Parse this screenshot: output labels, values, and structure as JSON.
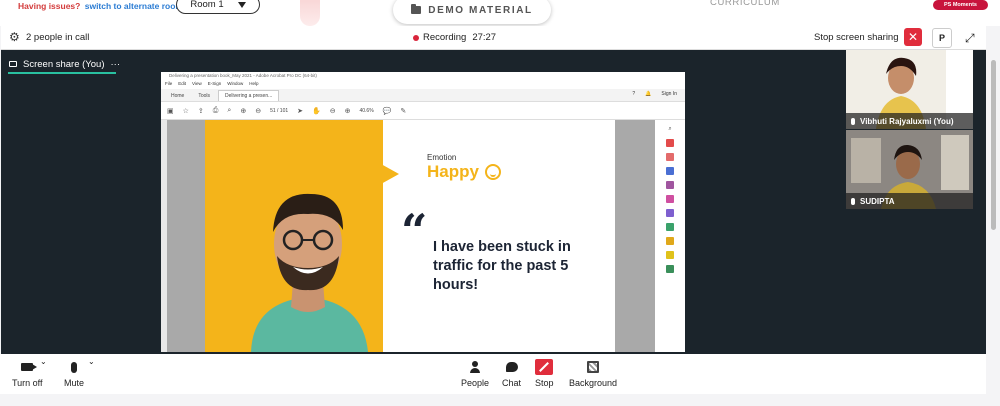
{
  "top": {
    "issues_text": "Having issues?",
    "alt_room_link": "switch to alternate room",
    "room_select": "Room 1",
    "demo_material": "DEMO MATERIAL",
    "curriculum": "CURRICULUM",
    "moments_badge": "PS Moments"
  },
  "header": {
    "people_in_call": "2 people in call",
    "recording_label": "Recording",
    "recording_time": "27:27",
    "stop_sharing": "Stop screen sharing",
    "p_button": "P"
  },
  "stage": {
    "share_tab_label": "Screen share (You)",
    "share_tab_more": "···"
  },
  "shared_app": {
    "title": "Delivering a presentation book_May 2021 - Adobe Acrobat Pro DC (64-bit)",
    "menu": [
      "File",
      "Edit",
      "View",
      "E-Sign",
      "Window",
      "Help"
    ],
    "tabs": [
      "Home",
      "Tools",
      "Delivering a presen..."
    ],
    "sign_in": "Sign In",
    "page_indicator": "51 / 101",
    "zoom": "40.6%"
  },
  "slide": {
    "emotion_label": "Emotion",
    "emotion_value": "Happy",
    "quote_mark": "“",
    "quote": "I have been stuck in traffic for the past 5 hours!"
  },
  "participants": [
    {
      "name": "Vibhuti Rajyaluxmi (You)"
    },
    {
      "name": "SUDIPTA"
    }
  ],
  "toolbar": {
    "turn_off": "Turn off",
    "mute": "Mute",
    "people": "People",
    "chat": "Chat",
    "stop": "Stop",
    "background": "Background"
  },
  "colors": {
    "accent_teal": "#29c0a0",
    "recording_red": "#d9253b",
    "slide_yellow": "#f4b41a",
    "slide_navy": "#1c2434",
    "stage_dark": "#1b242b"
  }
}
